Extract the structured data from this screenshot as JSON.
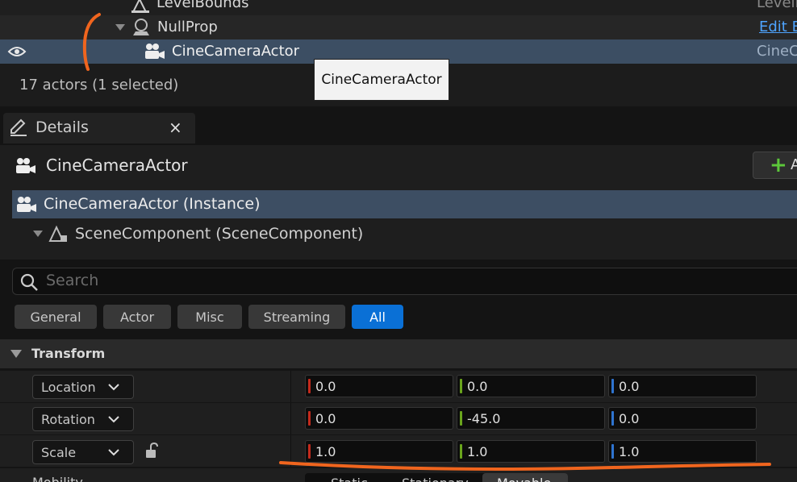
{
  "outliner": {
    "rows": [
      {
        "label": "LevelBounds",
        "right": "LevelB"
      },
      {
        "label": "NullProp",
        "right": "Edit B"
      },
      {
        "label": "CineCameraActor",
        "right": "CineC"
      }
    ],
    "status": "17 actors (1 selected)",
    "tooltip": "CineCameraActor"
  },
  "details": {
    "tab_label": "Details",
    "close_glyph": "×",
    "actor_name": "CineCameraActor",
    "add_button": "A",
    "instance_label": "CineCameraActor (Instance)",
    "component_label": "SceneComponent (SceneComponent)",
    "search_placeholder": "Search",
    "filters": [
      "General",
      "Actor",
      "Misc",
      "Streaming",
      "All"
    ],
    "active_filter": "All",
    "section": "Transform",
    "props": [
      {
        "label": "Location",
        "x": "0.0",
        "y": "0.0",
        "z": "0.0"
      },
      {
        "label": "Rotation",
        "x": "0.0",
        "y": "-45.0",
        "z": "0.0"
      },
      {
        "label": "Scale",
        "x": "1.0",
        "y": "1.0",
        "z": "1.0"
      }
    ],
    "mobility": {
      "label": "Mobility",
      "options": [
        "Static",
        "Stationary",
        "Movable"
      ]
    }
  },
  "colors": {
    "x_axis": "#c42a1c",
    "y_axis": "#6aa51c",
    "z_axis": "#2f74d0",
    "accent": "#0a70d6",
    "annotation": "#f0651e"
  }
}
